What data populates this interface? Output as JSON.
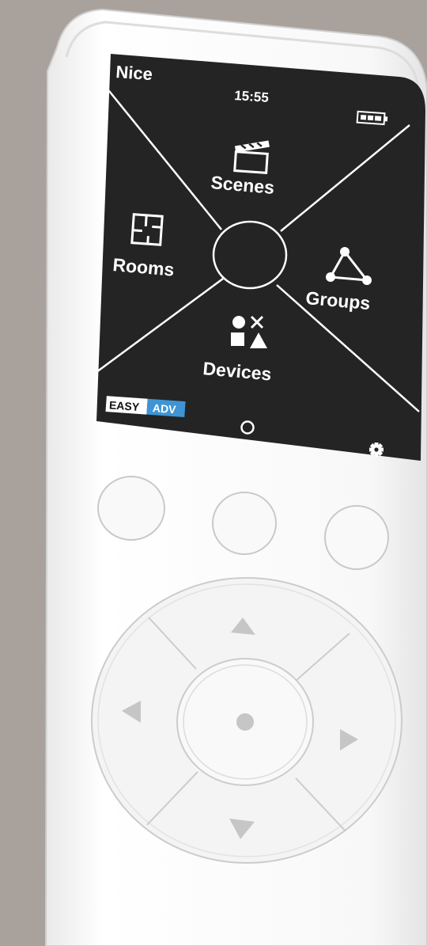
{
  "status_bar": {
    "brand": "Nice",
    "time": "15:55",
    "battery_icon": "battery-icon"
  },
  "menu": {
    "top_label": "Scenes",
    "top_icon": "clapperboard-icon",
    "left_label": "Rooms",
    "left_icon": "floorplan-icon",
    "right_label": "Groups",
    "right_icon": "network-triangle-icon",
    "bottom_label": "Devices",
    "bottom_icon": "shapes-icon"
  },
  "footer": {
    "mode_easy": "EASY",
    "mode_adv": "ADV",
    "home_icon": "circle-icon",
    "settings_icon": "gear-icon"
  },
  "colors": {
    "background": "#a9a19c",
    "screen": "#242424",
    "body": "#f6f6f6",
    "adv_accent": "#3f95d4",
    "arrow_gray": "#c6c6c6"
  }
}
